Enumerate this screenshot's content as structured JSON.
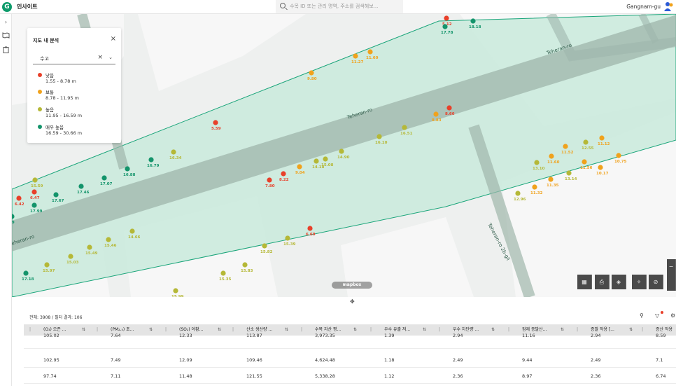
{
  "app": {
    "title": "인사이트",
    "logo_letter": "G",
    "search_placeholder": "수목 ID 또는 관리 명역, 주소를 검색해보...",
    "district": "Gangnam-gu"
  },
  "colors": {
    "low": "#e8402a",
    "normal": "#f0a21c",
    "high": "#b5b837",
    "very_high": "#14946b",
    "zone": "#c7e8db"
  },
  "panel": {
    "title": "지도 내 분석",
    "selected": "수고",
    "legend": [
      {
        "name": "낮음",
        "range": "1.55 - 8.78 m",
        "color": "#e8402a"
      },
      {
        "name": "보통",
        "range": "8.78 - 11.95 m",
        "color": "#f0a21c"
      },
      {
        "name": "높음",
        "range": "11.95 - 16.59 m",
        "color": "#b5b837"
      },
      {
        "name": "매우 높음",
        "range": "16.59 - 30.66 m",
        "color": "#14946b"
      }
    ]
  },
  "map": {
    "road_labels": [
      "Teheran-ro",
      "Teheran-ro",
      "eheran-ro",
      "Teheran-ro 2b-gil"
    ],
    "attribution": "mapbox",
    "points": [
      {
        "label": "5.12",
        "level": "low"
      },
      {
        "label": "18.18",
        "level": "very_high"
      },
      {
        "label": "17.78",
        "level": "very_high"
      },
      {
        "label": "11.27",
        "level": "normal"
      },
      {
        "label": "11.60",
        "level": "normal"
      },
      {
        "label": "9.80",
        "level": "normal"
      },
      {
        "label": "8.66",
        "level": "low"
      },
      {
        "label": "8.83",
        "level": "normal"
      },
      {
        "label": "5.59",
        "level": "low"
      },
      {
        "label": "16.51",
        "level": "high"
      },
      {
        "label": "16.10",
        "level": "high"
      },
      {
        "label": "16.34",
        "level": "high"
      },
      {
        "label": "16.79",
        "level": "very_high"
      },
      {
        "label": "16.88",
        "level": "very_high"
      },
      {
        "label": "17.07",
        "level": "very_high"
      },
      {
        "label": "17.46",
        "level": "very_high"
      },
      {
        "label": "17.67",
        "level": "very_high"
      },
      {
        "label": "17.99",
        "level": "very_high"
      },
      {
        "label": "6.47",
        "level": "low"
      },
      {
        "label": "6.42",
        "level": "low"
      },
      {
        "label": "15.59",
        "level": "high"
      },
      {
        "label": ".89",
        "level": "very_high"
      },
      {
        "label": "7.80",
        "level": "low"
      },
      {
        "label": "8.22",
        "level": "low"
      },
      {
        "label": "9.04",
        "level": "normal"
      },
      {
        "label": "14.18",
        "level": "high"
      },
      {
        "label": "15.08",
        "level": "high"
      },
      {
        "label": "14.90",
        "level": "high"
      },
      {
        "label": "12.55",
        "level": "high"
      },
      {
        "label": "11.12",
        "level": "normal"
      },
      {
        "label": "11.52",
        "level": "normal"
      },
      {
        "label": "13.10",
        "level": "high"
      },
      {
        "label": "11.60",
        "level": "normal"
      },
      {
        "label": "10.75",
        "level": "normal"
      },
      {
        "label": "10.17",
        "level": "normal"
      },
      {
        "label": "11.56",
        "level": "normal"
      },
      {
        "label": "13.14",
        "level": "high"
      },
      {
        "label": "11.35",
        "level": "normal"
      },
      {
        "label": "11.32",
        "level": "normal"
      },
      {
        "label": "12.96",
        "level": "high"
      },
      {
        "label": "6.69",
        "level": "low"
      },
      {
        "label": "15.39",
        "level": "high"
      },
      {
        "label": "15.82",
        "level": "high"
      },
      {
        "label": "15.83",
        "level": "high"
      },
      {
        "label": "15.35",
        "level": "high"
      },
      {
        "label": "15.99",
        "level": "high"
      },
      {
        "label": "14.66",
        "level": "high"
      },
      {
        "label": "15.46",
        "level": "high"
      },
      {
        "label": "15.49",
        "level": "high"
      },
      {
        "label": "15.03",
        "level": "high"
      },
      {
        "label": "15.97",
        "level": "high"
      },
      {
        "label": "17.18",
        "level": "very_high"
      }
    ]
  },
  "table": {
    "count_text": "전체: 3908 / 필터 결과: 106",
    "columns": [
      "(O₃) 오존 ...",
      "(PM₂.₅) 초...",
      "(SO₂) 아황...",
      "산소 생산량 ...",
      "수목 자산 평...",
      "우수 유출 저...",
      "우수 차단량 ...",
      "잠재 증발산...",
      "증발 작용 [...",
      "증산 작용"
    ],
    "rows": [
      [
        "105.02",
        "7.64",
        "12.33",
        "113.87",
        "3,973.35",
        "1.39",
        "2.94",
        "11.16",
        "2.94",
        "8.59"
      ],
      [
        "102.95",
        "7.49",
        "12.09",
        "109.46",
        "4,624.48",
        "1.18",
        "2.49",
        "9.44",
        "2.49",
        "7.1"
      ],
      [
        "97.74",
        "7.11",
        "11.48",
        "121.55",
        "5,338.28",
        "1.12",
        "2.36",
        "8.97",
        "2.36",
        "6.74"
      ]
    ]
  }
}
